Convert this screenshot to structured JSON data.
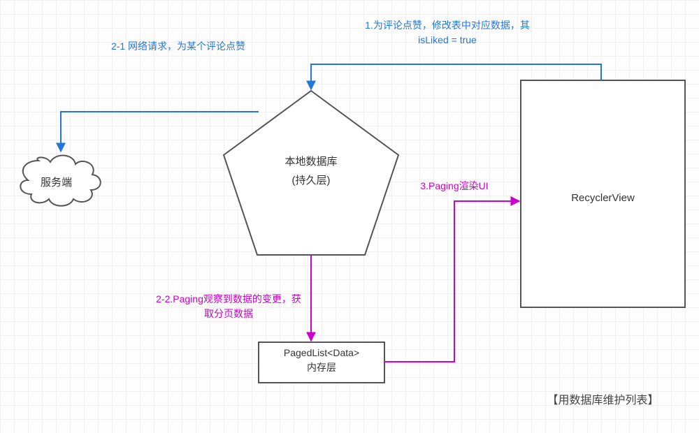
{
  "labels": {
    "step1": "1.为评论点赞，修改表中对应数据，其 isLiked = true",
    "step2_1": "2-1 网络请求，为某个评论点赞",
    "step2_2": "2-2.Paging观察到数据的变更，获取分页数据",
    "step3": "3.Paging渲染UI"
  },
  "nodes": {
    "server": "服务端",
    "db_line1": "本地数据库",
    "db_line2": "(持久层)",
    "pagedlist_line1": "PagedList<Data>",
    "pagedlist_line2": "内存层",
    "recyclerview": "RecyclerView"
  },
  "caption": "【用数据库维护列表】",
  "colors": {
    "blue": "#2277dd",
    "magenta": "#cc00cc",
    "black": "#555555"
  }
}
